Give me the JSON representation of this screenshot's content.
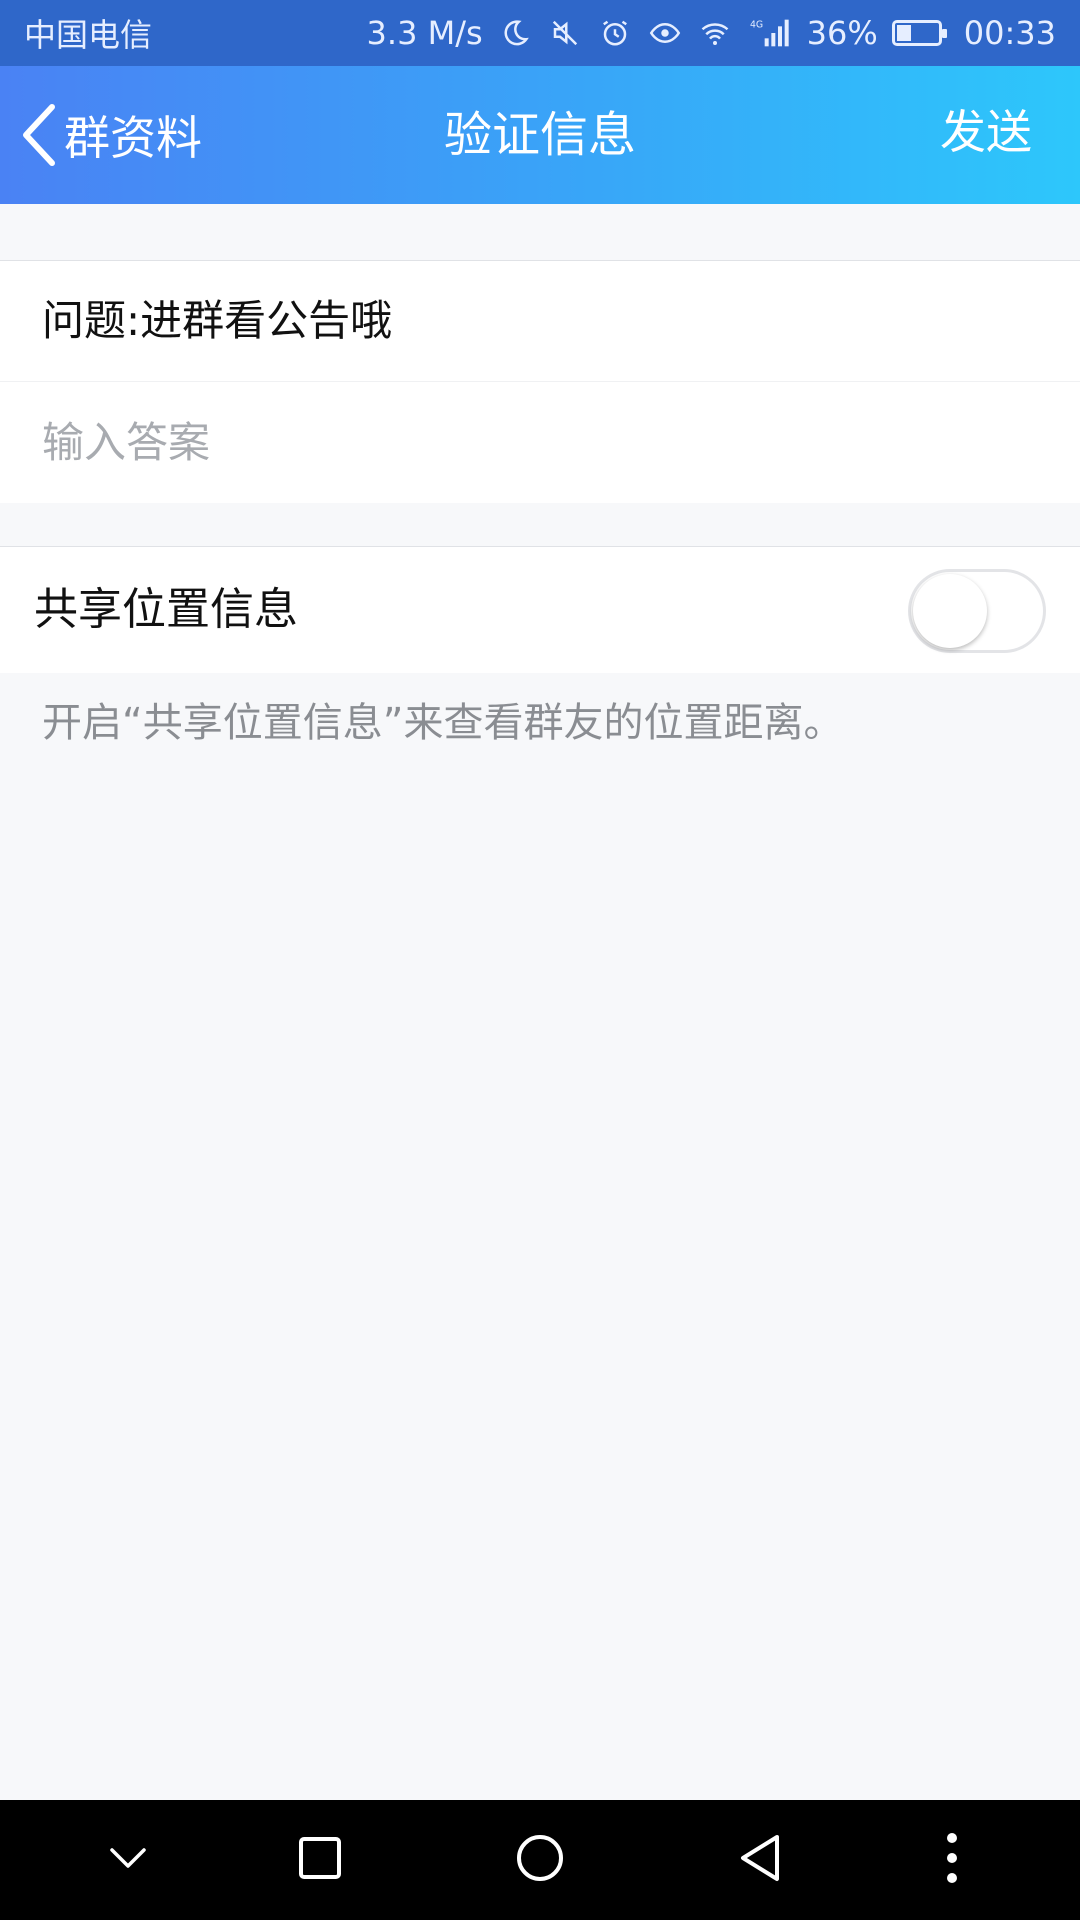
{
  "status_bar": {
    "carrier": "中国电信",
    "speed": "3.3 M/s",
    "network": "4G",
    "battery": "36%",
    "battery_level": 0.36,
    "time": "00:33",
    "icons": [
      "moon-icon",
      "mute-icon",
      "alarm-icon",
      "eye-icon",
      "wifi-icon",
      "signal-icon",
      "battery-icon"
    ]
  },
  "header": {
    "back_label": "群资料",
    "title": "验证信息",
    "send_label": "发送"
  },
  "question": {
    "text": "问题:进群看公告哦",
    "answer_value": "",
    "answer_placeholder": "输入答案"
  },
  "location": {
    "label": "共享位置信息",
    "enabled": false,
    "hint": "开启“共享位置信息”来查看群友的位置距离。"
  },
  "nav_bar": {
    "buttons": [
      "chevron-down-icon",
      "square-icon",
      "circle-icon",
      "triangle-back-icon",
      "more-vertical-icon"
    ]
  },
  "colors": {
    "header_start": "#4a82f4",
    "header_end": "#2dc7fb",
    "background": "#f7f8fa"
  }
}
